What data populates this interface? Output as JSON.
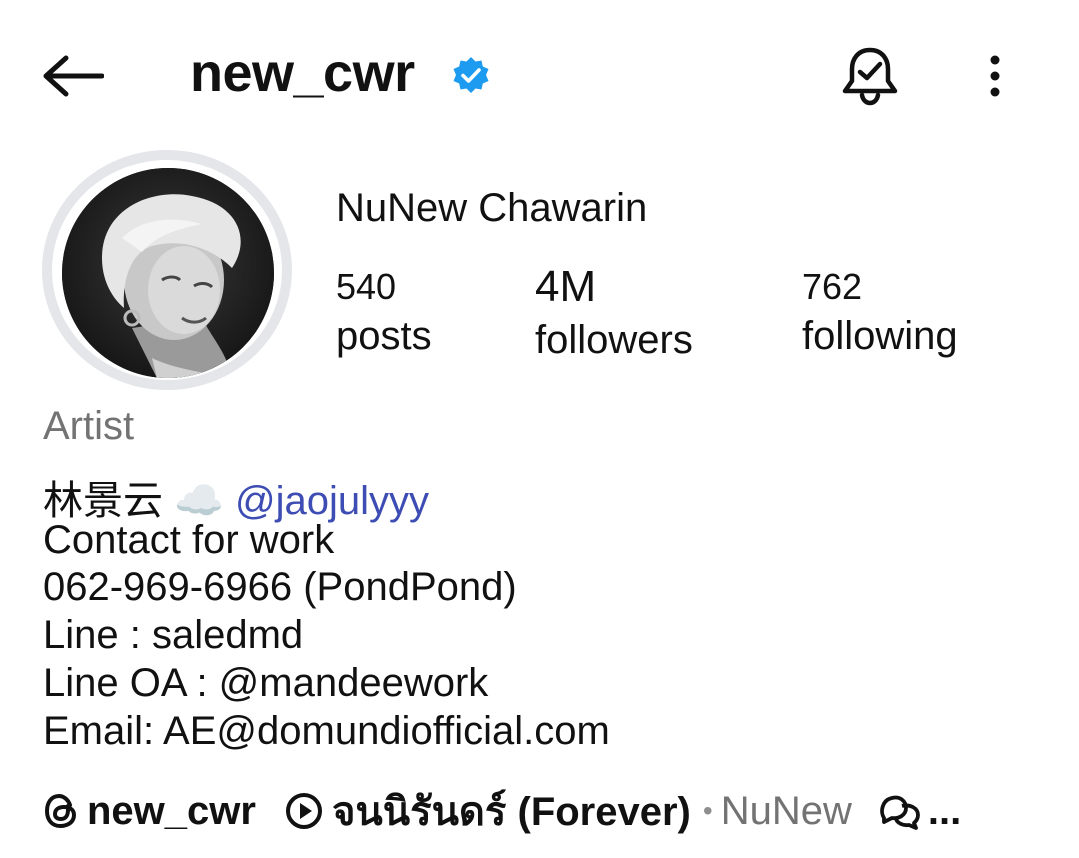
{
  "header": {
    "username": "new_cwr",
    "verified_color": "#1d9bf0"
  },
  "profile": {
    "display_name": "NuNew Chawarin",
    "stats": {
      "posts": {
        "value": "540",
        "label": "posts"
      },
      "followers": {
        "value": "4M",
        "label": "followers"
      },
      "following": {
        "value": "762",
        "label": "following"
      }
    },
    "category": "Artist",
    "bio": {
      "line1_text": "林景云 ☁️",
      "line1_mention": "@jaojulyyy",
      "line2": "Contact for work",
      "line3": "062-969-6966 (PondPond)",
      "line4": "Line : saledmd",
      "line5": "Line OA : @mandeework",
      "line6": "Email: AE@domundiofficial.com"
    }
  },
  "links": {
    "threads_username": "new_cwr",
    "music_title": "จนนิรันดร์ (Forever)",
    "music_separator": "•",
    "music_artist": "NuNew",
    "more": "..."
  },
  "icons": {
    "back": "arrow-left-icon",
    "verified": "verified-badge-icon",
    "bell": "notification-bell-icon",
    "more": "more-vertical-icon",
    "threads": "threads-icon",
    "play": "play-circle-icon",
    "chat": "chat-bubbles-icon"
  },
  "colors": {
    "text": "#111111",
    "muted": "#737373",
    "mention": "#3d4db3",
    "avatar_ring": "#e4e6ea"
  }
}
